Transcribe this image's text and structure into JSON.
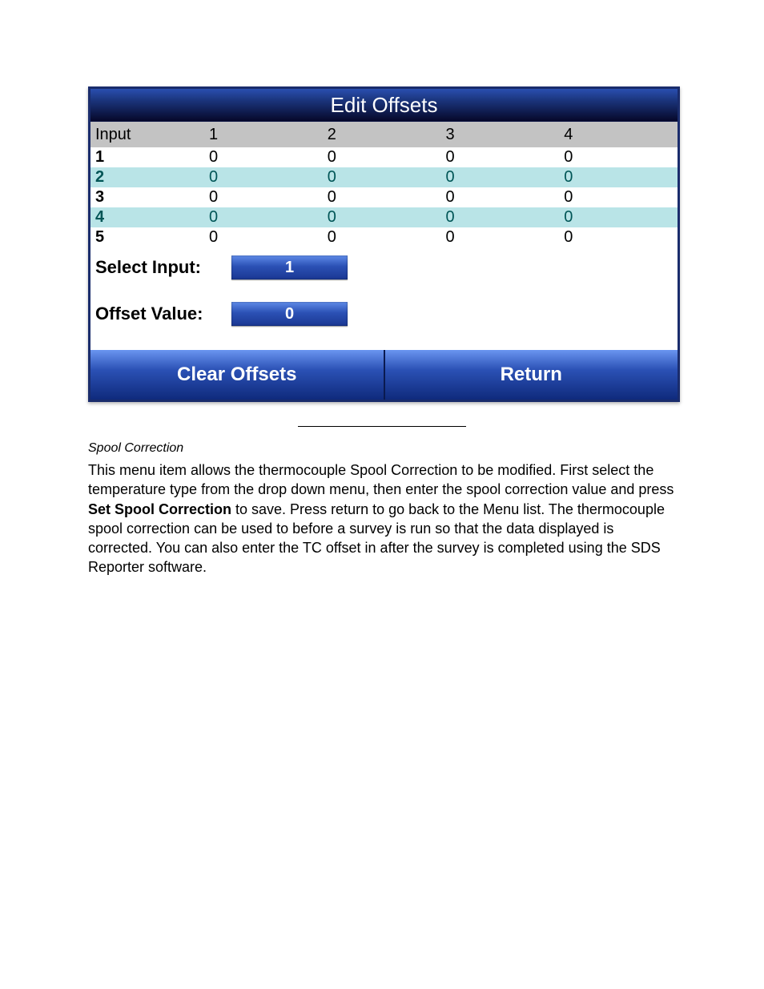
{
  "panel": {
    "title": "Edit Offsets",
    "header_label": "Input",
    "columns": [
      "1",
      "2",
      "3",
      "4"
    ],
    "rows": [
      {
        "label": "1",
        "values": [
          "0",
          "0",
          "0",
          "0"
        ]
      },
      {
        "label": "2",
        "values": [
          "0",
          "0",
          "0",
          "0"
        ]
      },
      {
        "label": "3",
        "values": [
          "0",
          "0",
          "0",
          "0"
        ]
      },
      {
        "label": "4",
        "values": [
          "0",
          "0",
          "0",
          "0"
        ]
      },
      {
        "label": "5",
        "values": [
          "0",
          "0",
          "0",
          "0"
        ]
      }
    ],
    "select_input_label": "Select Input:",
    "select_input_value": "1",
    "offset_value_label": "Offset Value:",
    "offset_value_value": "0",
    "clear_button": "Clear Offsets",
    "return_button": "Return"
  },
  "doc": {
    "heading": "Spool Correction",
    "body_pre": "This menu item allows the thermocouple Spool Correction to be modified.   First select the temperature type from the drop down menu, then enter the spool correction value and press ",
    "body_bold": "Set Spool Correction",
    "body_post": " to save.  Press return to go back to the Menu list. The thermocouple spool correction can be used to before a survey is run so that the data displayed is corrected.  You can also enter the TC offset in after the survey is completed using the SDS Reporter software."
  }
}
